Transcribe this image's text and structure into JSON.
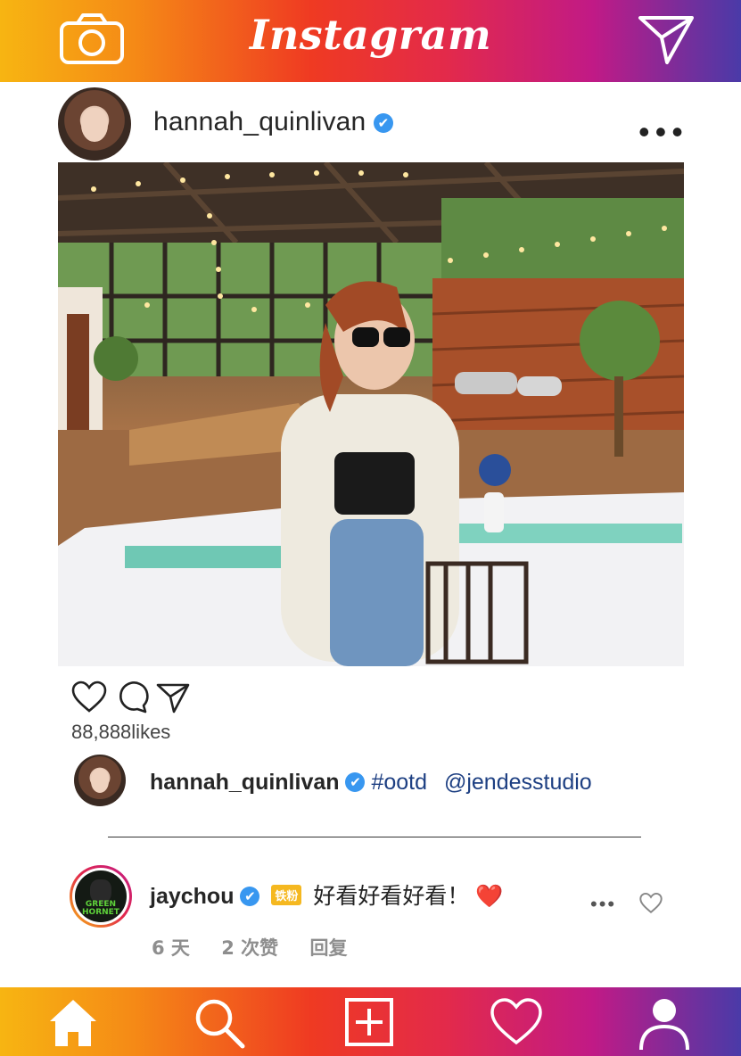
{
  "app": {
    "title": "Instagram",
    "gradient_colors": [
      "#f7b512",
      "#f58a16",
      "#ef3a22",
      "#e32a4a",
      "#c11a86",
      "#4a3aa8"
    ],
    "header_icons": [
      "camera-icon",
      "send-icon"
    ]
  },
  "post": {
    "username": "hannah_quinlivan",
    "verified_mark": "✔",
    "likes": "88,888likes",
    "actions": [
      "like-icon",
      "comment-icon",
      "share-icon"
    ]
  },
  "caption": {
    "username": "hannah_quinlivan",
    "verified_mark": "✔",
    "hashtag": "#ootd",
    "mention": "@jendesstudio"
  },
  "comment": {
    "avatar_text": "GREEN HORNET",
    "username": "jaychou",
    "verified_mark": "✔",
    "badge": "铁粉",
    "text": "好看好看好看！",
    "emoji": "❤️",
    "more": "•••",
    "time": "6 天",
    "likes": "2 次赞",
    "reply": "回复"
  },
  "bottom_nav": [
    "home-icon",
    "search-icon",
    "add-post-icon",
    "activity-heart-icon",
    "profile-icon"
  ]
}
